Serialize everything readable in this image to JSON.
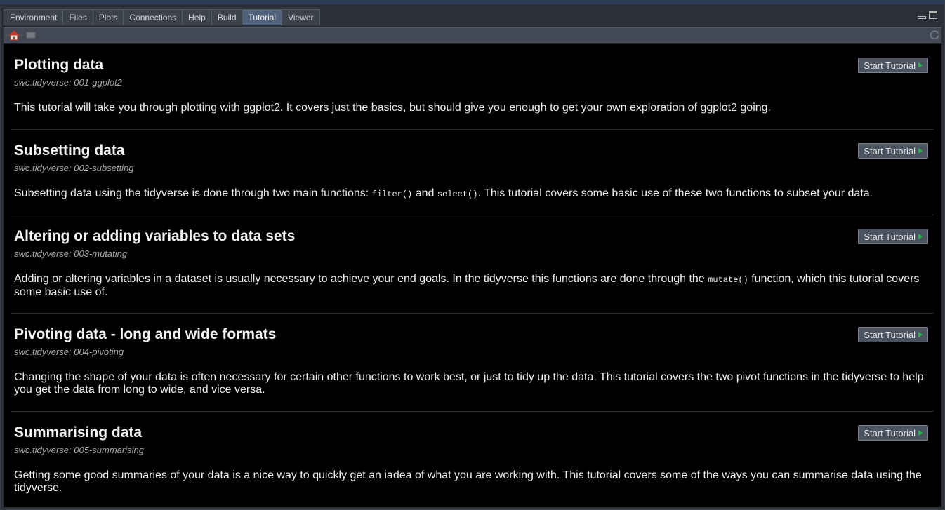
{
  "tabs": [
    {
      "label": "Environment"
    },
    {
      "label": "Files"
    },
    {
      "label": "Plots"
    },
    {
      "label": "Connections"
    },
    {
      "label": "Help"
    },
    {
      "label": "Build"
    },
    {
      "label": "Tutorial",
      "active": true
    },
    {
      "label": "Viewer"
    }
  ],
  "toolbar": {
    "icons": [
      "home-icon",
      "stop-icon",
      "refresh-icon"
    ]
  },
  "start_button_label": "Start Tutorial",
  "tutorials": [
    {
      "title": "Plotting data",
      "id": "swc.tidyverse: 001-ggplot2",
      "desc": [
        "This tutorial will take you through plotting with ggplot2. It covers just the basics, but should give you enough to get your own exploration of ggplot2 going."
      ],
      "code": []
    },
    {
      "title": "Subsetting data",
      "id": "swc.tidyverse: 002-subsetting",
      "desc": [
        "Subsetting data using the tidyverse is done through two main functions: ",
        " and ",
        ". This tutorial covers some basic use of these two functions to subset your data."
      ],
      "code": [
        "filter()",
        "select()"
      ]
    },
    {
      "title": "Altering or adding variables to data sets",
      "id": "swc.tidyverse: 003-mutating",
      "desc": [
        "Adding or altering variables in a dataset is usually necessary to achieve your end goals. In the tidyverse this functions are done through the ",
        " function, which this tutorial covers some basic use of."
      ],
      "code": [
        "mutate()"
      ]
    },
    {
      "title": "Pivoting data - long and wide formats",
      "id": "swc.tidyverse: 004-pivoting",
      "desc": [
        "Changing the shape of your data is often necessary for certain other functions to work best, or just to tidy up the data. This tutorial covers the two pivot functions in the tidyverse to help you get the data from long to wide, and vice versa."
      ],
      "code": []
    },
    {
      "title": "Summarising data",
      "id": "swc.tidyverse: 005-summarising",
      "desc": [
        "Getting some good summaries of your data is a nice way to quickly get an iadea of what you are working with. This tutorial covers some of the ways you can summarise data using the tidyverse."
      ],
      "code": []
    }
  ],
  "colors": {
    "active_tab": "#50627c",
    "content_bg": "#000000",
    "play_green": "#2bb24c"
  }
}
